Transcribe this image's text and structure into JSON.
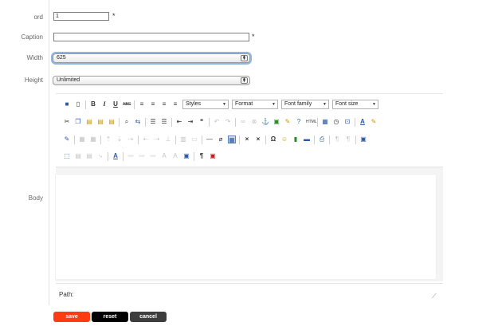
{
  "form": {
    "ord_label": "ord",
    "ord_value": "1",
    "caption_label": "Caption",
    "caption_value": "",
    "required_mark": "*",
    "width_label": "Width",
    "width_value": "625",
    "height_label": "Height",
    "height_value": "Unlimited",
    "body_label": "Body"
  },
  "editor": {
    "styles_label": "Styles",
    "format_label": "Format",
    "font_family_label": "Font family",
    "font_size_label": "Font size",
    "path_label": "Path:",
    "html_icon_text": "HTML"
  },
  "buttons": {
    "save": "save",
    "reset": "reset",
    "cancel": "cancel"
  },
  "colors": {
    "save": "#ff3b12",
    "reset": "#000000",
    "cancel": "#3d3d3d",
    "focus": "#8fb5e0"
  }
}
